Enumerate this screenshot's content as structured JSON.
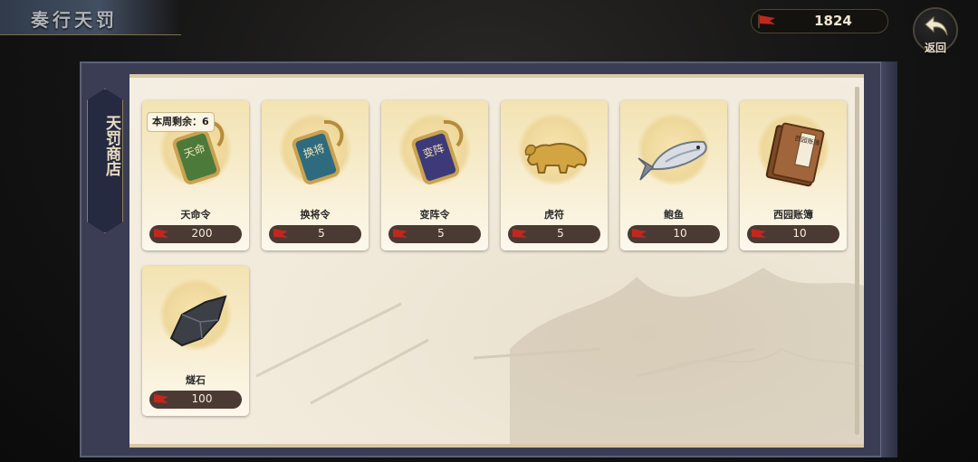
{
  "header": {
    "title": "奏行天罚"
  },
  "currency": {
    "amount": "1824",
    "icon": "red-flag-icon"
  },
  "back_button": {
    "label": "返回",
    "icon": "back-arrow-icon"
  },
  "shop": {
    "label": "天罚商店"
  },
  "weekly_tooltip": "本周剩余：6",
  "items": [
    {
      "name": "天命令",
      "price": "200"
    },
    {
      "name": "换将令",
      "price": "5"
    },
    {
      "name": "变阵令",
      "price": "5"
    },
    {
      "name": "虎符",
      "price": "5"
    },
    {
      "name": "鲍鱼",
      "price": "10"
    },
    {
      "name": "西园账簿",
      "price": "10"
    },
    {
      "name": "燧石",
      "price": "100"
    }
  ],
  "token_texts": {
    "tianming": "天命",
    "huanjiang": "换将",
    "bianzhen": "变阵"
  },
  "book_label": "西园账簿",
  "colors": {
    "accent": "#c0281f",
    "price_bar": "#4b3a34",
    "frame": "#3a3d54"
  }
}
